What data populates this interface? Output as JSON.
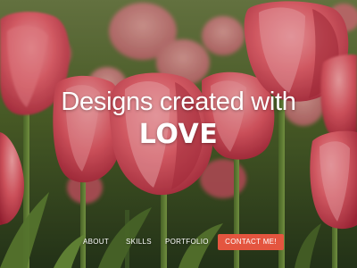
{
  "hero": {
    "headline_line1": "Designs created with",
    "headline_line2": "LOVE"
  },
  "nav": {
    "items": [
      {
        "label": "ABOUT"
      },
      {
        "label": "SKILLS"
      },
      {
        "label": "PORTFOLIO"
      }
    ],
    "cta_label": "CONTACT ME!"
  },
  "colors": {
    "cta_background": "#e4553f",
    "text": "#ffffff",
    "tulip_red": "#d94a55",
    "foliage_green": "#3f5a25"
  }
}
